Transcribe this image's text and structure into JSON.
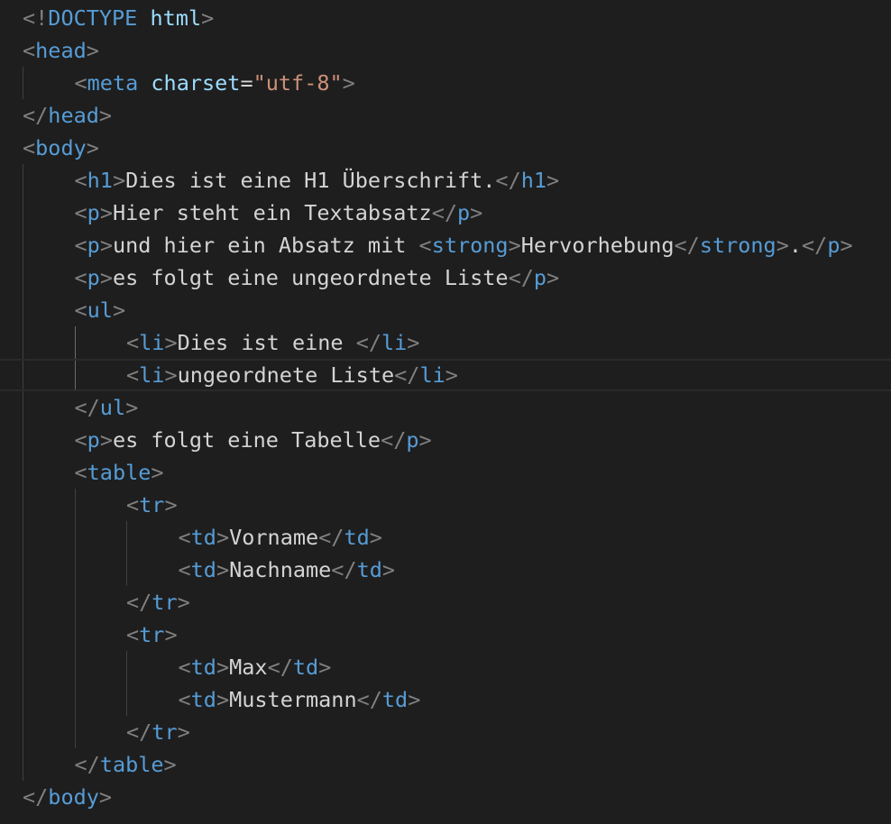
{
  "editor": {
    "language": "html",
    "lines": [
      {
        "indent": 0,
        "tokens": [
          [
            "p",
            "<!"
          ],
          [
            "k",
            "DOCTYPE"
          ],
          [
            "x",
            " "
          ],
          [
            "h",
            "html"
          ],
          [
            "p",
            ">"
          ]
        ]
      },
      {
        "indent": 0,
        "tokens": [
          [
            "p",
            "<"
          ],
          [
            "t",
            "head"
          ],
          [
            "p",
            ">"
          ]
        ]
      },
      {
        "indent": 1,
        "tokens": [
          [
            "p",
            "<"
          ],
          [
            "t",
            "meta"
          ],
          [
            "x",
            " "
          ],
          [
            "a",
            "charset"
          ],
          [
            "x",
            "="
          ],
          [
            "s",
            "\"utf-8\""
          ],
          [
            "p",
            ">"
          ]
        ]
      },
      {
        "indent": 0,
        "tokens": [
          [
            "p",
            "</"
          ],
          [
            "t",
            "head"
          ],
          [
            "p",
            ">"
          ]
        ]
      },
      {
        "indent": 0,
        "tokens": [
          [
            "p",
            "<"
          ],
          [
            "t",
            "body"
          ],
          [
            "p",
            ">"
          ]
        ]
      },
      {
        "indent": 1,
        "tokens": [
          [
            "p",
            "<"
          ],
          [
            "t",
            "h1"
          ],
          [
            "p",
            ">"
          ],
          [
            "x",
            "Dies ist eine H1 Überschrift."
          ],
          [
            "p",
            "</"
          ],
          [
            "t",
            "h1"
          ],
          [
            "p",
            ">"
          ]
        ]
      },
      {
        "indent": 1,
        "tokens": [
          [
            "p",
            "<"
          ],
          [
            "t",
            "p"
          ],
          [
            "p",
            ">"
          ],
          [
            "x",
            "Hier steht ein Textabsatz"
          ],
          [
            "p",
            "</"
          ],
          [
            "t",
            "p"
          ],
          [
            "p",
            ">"
          ]
        ]
      },
      {
        "indent": 1,
        "tokens": [
          [
            "p",
            "<"
          ],
          [
            "t",
            "p"
          ],
          [
            "p",
            ">"
          ],
          [
            "x",
            "und hier ein Absatz mit "
          ],
          [
            "p",
            "<"
          ],
          [
            "t",
            "strong"
          ],
          [
            "p",
            ">"
          ],
          [
            "x",
            "Hervorhebung"
          ],
          [
            "p",
            "</"
          ],
          [
            "t",
            "strong"
          ],
          [
            "p",
            ">"
          ],
          [
            "x",
            "."
          ],
          [
            "p",
            "</"
          ],
          [
            "t",
            "p"
          ],
          [
            "p",
            ">"
          ]
        ]
      },
      {
        "indent": 1,
        "tokens": [
          [
            "p",
            "<"
          ],
          [
            "t",
            "p"
          ],
          [
            "p",
            ">"
          ],
          [
            "x",
            "es folgt eine ungeordnete Liste"
          ],
          [
            "p",
            "</"
          ],
          [
            "t",
            "p"
          ],
          [
            "p",
            ">"
          ]
        ]
      },
      {
        "indent": 1,
        "tokens": [
          [
            "p",
            "<"
          ],
          [
            "t",
            "ul"
          ],
          [
            "p",
            ">"
          ]
        ]
      },
      {
        "indent": 2,
        "tokens": [
          [
            "p",
            "<"
          ],
          [
            "t",
            "li"
          ],
          [
            "p",
            ">"
          ],
          [
            "x",
            "Dies ist eine "
          ],
          [
            "p",
            "</"
          ],
          [
            "t",
            "li"
          ],
          [
            "p",
            ">"
          ]
        ]
      },
      {
        "indent": 2,
        "current": true,
        "tokens": [
          [
            "p",
            "<"
          ],
          [
            "t",
            "li"
          ],
          [
            "p",
            ">"
          ],
          [
            "x",
            "ungeordnete Liste"
          ],
          [
            "p",
            "</"
          ],
          [
            "t",
            "li"
          ],
          [
            "p",
            ">"
          ]
        ]
      },
      {
        "indent": 1,
        "tokens": [
          [
            "p",
            "</"
          ],
          [
            "t",
            "ul"
          ],
          [
            "p",
            ">"
          ]
        ]
      },
      {
        "indent": 1,
        "tokens": [
          [
            "p",
            "<"
          ],
          [
            "t",
            "p"
          ],
          [
            "p",
            ">"
          ],
          [
            "x",
            "es folgt eine Tabelle"
          ],
          [
            "p",
            "</"
          ],
          [
            "t",
            "p"
          ],
          [
            "p",
            ">"
          ]
        ]
      },
      {
        "indent": 1,
        "tokens": [
          [
            "p",
            "<"
          ],
          [
            "t",
            "table"
          ],
          [
            "p",
            ">"
          ]
        ]
      },
      {
        "indent": 2,
        "tokens": [
          [
            "p",
            "<"
          ],
          [
            "t",
            "tr"
          ],
          [
            "p",
            ">"
          ]
        ]
      },
      {
        "indent": 3,
        "tokens": [
          [
            "p",
            "<"
          ],
          [
            "t",
            "td"
          ],
          [
            "p",
            ">"
          ],
          [
            "x",
            "Vorname"
          ],
          [
            "p",
            "</"
          ],
          [
            "t",
            "td"
          ],
          [
            "p",
            ">"
          ]
        ]
      },
      {
        "indent": 3,
        "tokens": [
          [
            "p",
            "<"
          ],
          [
            "t",
            "td"
          ],
          [
            "p",
            ">"
          ],
          [
            "x",
            "Nachname"
          ],
          [
            "p",
            "</"
          ],
          [
            "t",
            "td"
          ],
          [
            "p",
            ">"
          ]
        ]
      },
      {
        "indent": 2,
        "tokens": [
          [
            "p",
            "</"
          ],
          [
            "t",
            "tr"
          ],
          [
            "p",
            ">"
          ]
        ]
      },
      {
        "indent": 2,
        "tokens": [
          [
            "p",
            "<"
          ],
          [
            "t",
            "tr"
          ],
          [
            "p",
            ">"
          ]
        ]
      },
      {
        "indent": 3,
        "tokens": [
          [
            "p",
            "<"
          ],
          [
            "t",
            "td"
          ],
          [
            "p",
            ">"
          ],
          [
            "x",
            "Max"
          ],
          [
            "p",
            "</"
          ],
          [
            "t",
            "td"
          ],
          [
            "p",
            ">"
          ]
        ]
      },
      {
        "indent": 3,
        "tokens": [
          [
            "p",
            "<"
          ],
          [
            "t",
            "td"
          ],
          [
            "p",
            ">"
          ],
          [
            "x",
            "Mustermann"
          ],
          [
            "p",
            "</"
          ],
          [
            "t",
            "td"
          ],
          [
            "p",
            ">"
          ]
        ]
      },
      {
        "indent": 2,
        "tokens": [
          [
            "p",
            "</"
          ],
          [
            "t",
            "tr"
          ],
          [
            "p",
            ">"
          ]
        ]
      },
      {
        "indent": 1,
        "tokens": [
          [
            "p",
            "</"
          ],
          [
            "t",
            "table"
          ],
          [
            "p",
            ">"
          ]
        ]
      },
      {
        "indent": 0,
        "tokens": [
          [
            "p",
            "</"
          ],
          [
            "t",
            "body"
          ],
          [
            "p",
            ">"
          ]
        ]
      }
    ]
  },
  "colors": {
    "background": "#1e1e1e",
    "punctuation": "#808080",
    "tag": "#569cd6",
    "attribute": "#9cdcfe",
    "string": "#ce9178",
    "text": "#d4d4d4"
  }
}
